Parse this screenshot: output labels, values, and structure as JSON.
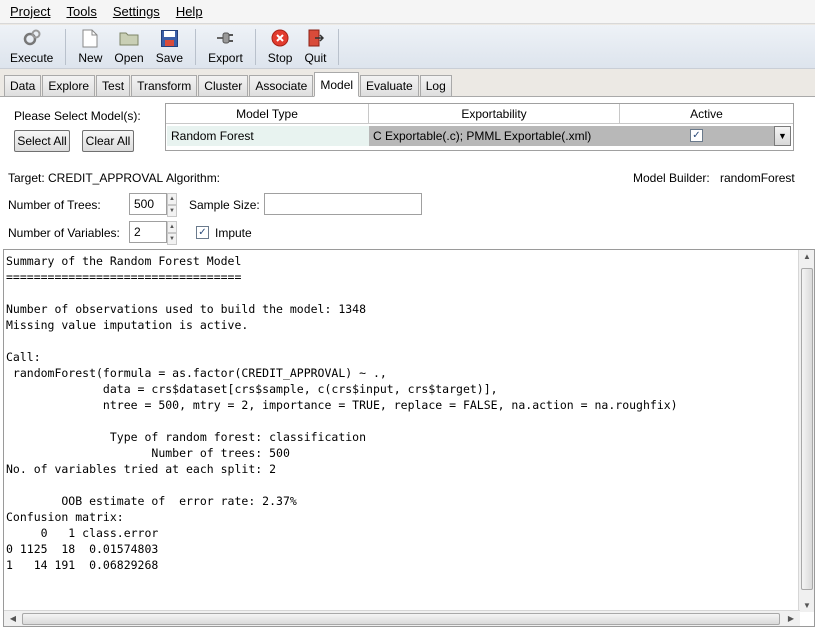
{
  "menu": [
    {
      "label": "Project"
    },
    {
      "label": "Tools"
    },
    {
      "label": "Settings"
    },
    {
      "label": "Help"
    }
  ],
  "toolbar": {
    "execute": "Execute",
    "new": "New",
    "open": "Open",
    "save": "Save",
    "export": "Export",
    "stop": "Stop",
    "quit": "Quit"
  },
  "tabs": [
    "Data",
    "Explore",
    "Test",
    "Transform",
    "Cluster",
    "Associate",
    "Model",
    "Evaluate",
    "Log"
  ],
  "active_tab": "Model",
  "model": {
    "select_label": "Please Select Model(s):",
    "select_all": "Select All",
    "clear_all": "Clear All",
    "table": {
      "headers": [
        "Model Type",
        "Exportability",
        "Active"
      ],
      "row": {
        "type": "Random Forest",
        "exportability": "C Exportable(.c); PMML Exportable(.xml)",
        "active": "✓"
      }
    },
    "target": "Target: CREDIT_APPROVAL",
    "algorithm": "Algorithm:",
    "model_builder_label": "Model Builder:",
    "model_builder_value": "randomForest",
    "num_trees_label": "Number of Trees:",
    "num_trees_value": "500",
    "sample_size_label": "Sample Size:",
    "sample_size_value": "",
    "num_vars_label": "Number of Variables:",
    "num_vars_value": "2",
    "impute_label": "Impute",
    "impute_checked": "✓"
  },
  "output_text": "Summary of the Random Forest Model\n==================================\n\nNumber of observations used to build the model: 1348\nMissing value imputation is active.\n\nCall:\n randomForest(formula = as.factor(CREDIT_APPROVAL) ~ .,\n              data = crs$dataset[crs$sample, c(crs$input, crs$target)],\n              ntree = 500, mtry = 2, importance = TRUE, replace = FALSE, na.action = na.roughfix)\n\n               Type of random forest: classification\n                     Number of trees: 500\nNo. of variables tried at each split: 2\n\n        OOB estimate of  error rate: 2.37%\nConfusion matrix:\n     0   1 class.error\n0 1125  18  0.01574803\n1   14 191  0.06829268",
  "colors": {
    "stop_red": "#e23b2e",
    "table_selected_bg": "#b8b8b8"
  }
}
